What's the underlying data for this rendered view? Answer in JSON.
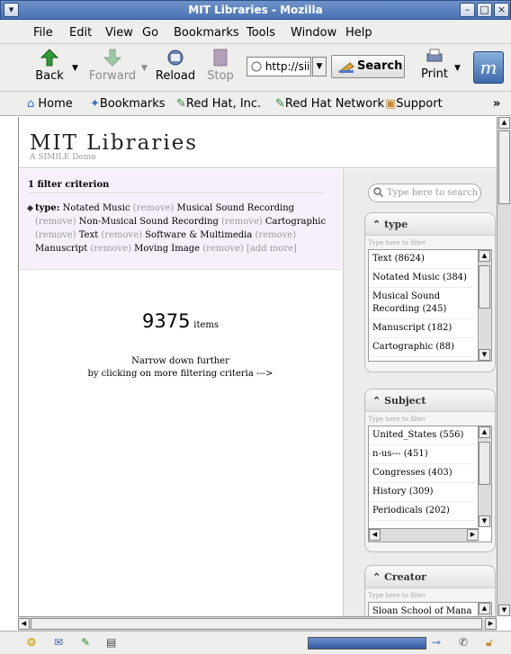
{
  "window": {
    "title": "MIT Libraries - Mozilla"
  },
  "menu": [
    "File",
    "Edit",
    "View",
    "Go",
    "Bookmarks",
    "Tools",
    "Window",
    "Help"
  ],
  "toolbar": {
    "back": "Back",
    "forward": "Forward",
    "reload": "Reload",
    "stop": "Stop",
    "url": "http://sii",
    "search": "Search",
    "print": "Print"
  },
  "personal_toolbar": [
    "Home",
    "Bookmarks",
    "Red Hat, Inc.",
    "Red Hat Network",
    "Support"
  ],
  "page": {
    "title": "MIT Libraries",
    "subtitle": "A SIMILE Demo",
    "filter_header": "1 filter criterion",
    "filter": {
      "label": "type:",
      "remove": "(remove)",
      "values": [
        "Notated Music",
        "Musical Sound Recording",
        "Non-Musical Sound Recording",
        "Cartographic",
        "Text",
        "Software & Multimedia",
        "Manuscript",
        "Moving Image"
      ],
      "add_more": "[add more]"
    },
    "count": "9375",
    "count_label": "items",
    "narrow_line1": "Narrow down further",
    "narrow_line2": "by clicking on more filtering criteria --->",
    "search_placeholder": "Type here to search",
    "facets": [
      {
        "title": "type",
        "filter_placeholder": "Type here to filter",
        "items": [
          "Text (8624)",
          "Notated Music (384)",
          "Musical Sound Recording (245)",
          "Manuscript (182)",
          "Cartographic (88)"
        ]
      },
      {
        "title": "Subject",
        "filter_placeholder": "Type here to filter",
        "items": [
          "United_States (556)",
          "n-us--- (451)",
          "Congresses (403)",
          "History (309)",
          "Periodicals (202)"
        ]
      },
      {
        "title": "Creator",
        "filter_placeholder": "Type here to filter",
        "items": [
          "Sloan School of Mana"
        ]
      }
    ]
  },
  "colors": {
    "titlebar": "#4a72b4",
    "filter_bg": "#f7f0fa",
    "sidebar_bg": "#ececec"
  }
}
